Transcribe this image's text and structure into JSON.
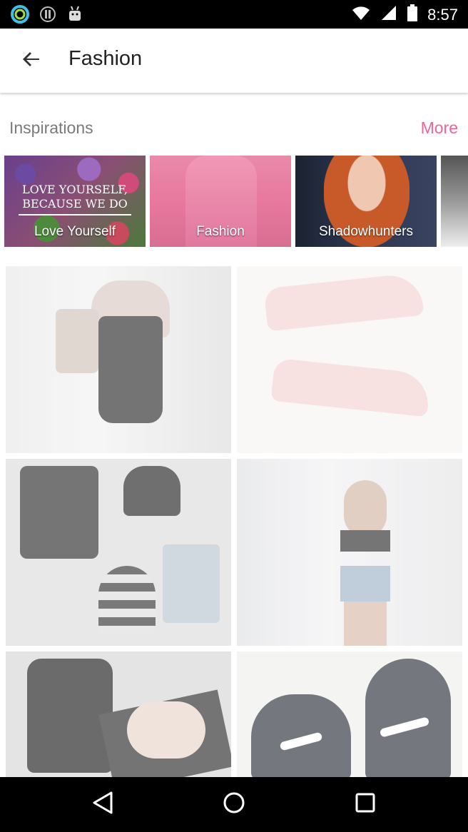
{
  "status_bar": {
    "time": "8:57",
    "icons": [
      "circle-app-icon",
      "info-icon",
      "android-icon",
      "wifi-icon",
      "signal-icon",
      "battery-icon"
    ]
  },
  "app_bar": {
    "title": "Fashion",
    "back_icon": "arrow-left-icon"
  },
  "inspirations": {
    "title": "Inspirations",
    "more_label": "More",
    "accent_color": "#f0649a",
    "cards": [
      {
        "label": "Love Yourself",
        "image_text_line1": "LOVE YOURSELF,",
        "image_text_line2": "BECAUSE WE DO"
      },
      {
        "label": "Fashion"
      },
      {
        "label": "Shadowhunters"
      },
      {
        "label": ""
      }
    ]
  },
  "photo_grid": {
    "items": [
      {
        "name": "photo-outfit-black-dress"
      },
      {
        "name": "photo-pink-sneakers"
      },
      {
        "name": "photo-flatlay-vest"
      },
      {
        "name": "photo-girl-denim-shorts"
      },
      {
        "name": "photo-black-boots"
      },
      {
        "name": "photo-nike-sneakers"
      }
    ]
  },
  "nav_bar": {
    "icons": [
      "back-triangle-icon",
      "home-circle-icon",
      "recents-square-icon"
    ]
  }
}
